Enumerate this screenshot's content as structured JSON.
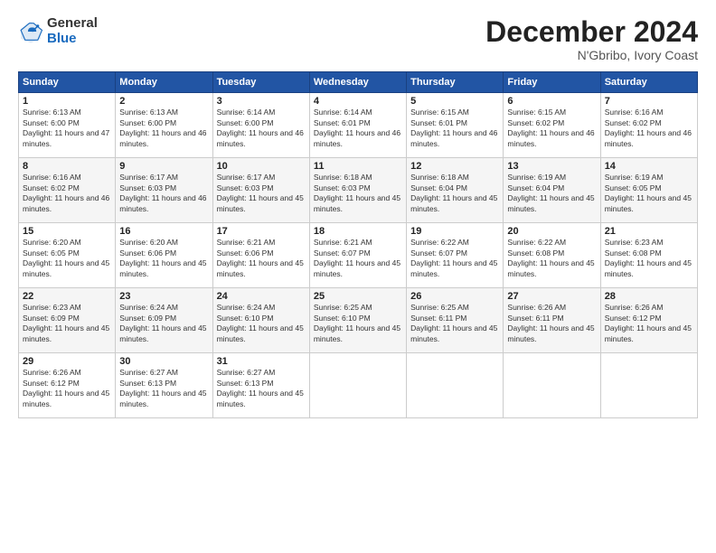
{
  "header": {
    "logo_general": "General",
    "logo_blue": "Blue",
    "month_title": "December 2024",
    "location": "N'Gbribo, Ivory Coast"
  },
  "columns": [
    "Sunday",
    "Monday",
    "Tuesday",
    "Wednesday",
    "Thursday",
    "Friday",
    "Saturday"
  ],
  "weeks": [
    [
      {
        "day": "1",
        "sunrise": "6:13 AM",
        "sunset": "6:00 PM",
        "daylight": "11 hours and 47 minutes."
      },
      {
        "day": "2",
        "sunrise": "6:13 AM",
        "sunset": "6:00 PM",
        "daylight": "11 hours and 46 minutes."
      },
      {
        "day": "3",
        "sunrise": "6:14 AM",
        "sunset": "6:00 PM",
        "daylight": "11 hours and 46 minutes."
      },
      {
        "day": "4",
        "sunrise": "6:14 AM",
        "sunset": "6:01 PM",
        "daylight": "11 hours and 46 minutes."
      },
      {
        "day": "5",
        "sunrise": "6:15 AM",
        "sunset": "6:01 PM",
        "daylight": "11 hours and 46 minutes."
      },
      {
        "day": "6",
        "sunrise": "6:15 AM",
        "sunset": "6:02 PM",
        "daylight": "11 hours and 46 minutes."
      },
      {
        "day": "7",
        "sunrise": "6:16 AM",
        "sunset": "6:02 PM",
        "daylight": "11 hours and 46 minutes."
      }
    ],
    [
      {
        "day": "8",
        "sunrise": "6:16 AM",
        "sunset": "6:02 PM",
        "daylight": "11 hours and 46 minutes."
      },
      {
        "day": "9",
        "sunrise": "6:17 AM",
        "sunset": "6:03 PM",
        "daylight": "11 hours and 46 minutes."
      },
      {
        "day": "10",
        "sunrise": "6:17 AM",
        "sunset": "6:03 PM",
        "daylight": "11 hours and 45 minutes."
      },
      {
        "day": "11",
        "sunrise": "6:18 AM",
        "sunset": "6:03 PM",
        "daylight": "11 hours and 45 minutes."
      },
      {
        "day": "12",
        "sunrise": "6:18 AM",
        "sunset": "6:04 PM",
        "daylight": "11 hours and 45 minutes."
      },
      {
        "day": "13",
        "sunrise": "6:19 AM",
        "sunset": "6:04 PM",
        "daylight": "11 hours and 45 minutes."
      },
      {
        "day": "14",
        "sunrise": "6:19 AM",
        "sunset": "6:05 PM",
        "daylight": "11 hours and 45 minutes."
      }
    ],
    [
      {
        "day": "15",
        "sunrise": "6:20 AM",
        "sunset": "6:05 PM",
        "daylight": "11 hours and 45 minutes."
      },
      {
        "day": "16",
        "sunrise": "6:20 AM",
        "sunset": "6:06 PM",
        "daylight": "11 hours and 45 minutes."
      },
      {
        "day": "17",
        "sunrise": "6:21 AM",
        "sunset": "6:06 PM",
        "daylight": "11 hours and 45 minutes."
      },
      {
        "day": "18",
        "sunrise": "6:21 AM",
        "sunset": "6:07 PM",
        "daylight": "11 hours and 45 minutes."
      },
      {
        "day": "19",
        "sunrise": "6:22 AM",
        "sunset": "6:07 PM",
        "daylight": "11 hours and 45 minutes."
      },
      {
        "day": "20",
        "sunrise": "6:22 AM",
        "sunset": "6:08 PM",
        "daylight": "11 hours and 45 minutes."
      },
      {
        "day": "21",
        "sunrise": "6:23 AM",
        "sunset": "6:08 PM",
        "daylight": "11 hours and 45 minutes."
      }
    ],
    [
      {
        "day": "22",
        "sunrise": "6:23 AM",
        "sunset": "6:09 PM",
        "daylight": "11 hours and 45 minutes."
      },
      {
        "day": "23",
        "sunrise": "6:24 AM",
        "sunset": "6:09 PM",
        "daylight": "11 hours and 45 minutes."
      },
      {
        "day": "24",
        "sunrise": "6:24 AM",
        "sunset": "6:10 PM",
        "daylight": "11 hours and 45 minutes."
      },
      {
        "day": "25",
        "sunrise": "6:25 AM",
        "sunset": "6:10 PM",
        "daylight": "11 hours and 45 minutes."
      },
      {
        "day": "26",
        "sunrise": "6:25 AM",
        "sunset": "6:11 PM",
        "daylight": "11 hours and 45 minutes."
      },
      {
        "day": "27",
        "sunrise": "6:26 AM",
        "sunset": "6:11 PM",
        "daylight": "11 hours and 45 minutes."
      },
      {
        "day": "28",
        "sunrise": "6:26 AM",
        "sunset": "6:12 PM",
        "daylight": "11 hours and 45 minutes."
      }
    ],
    [
      {
        "day": "29",
        "sunrise": "6:26 AM",
        "sunset": "6:12 PM",
        "daylight": "11 hours and 45 minutes."
      },
      {
        "day": "30",
        "sunrise": "6:27 AM",
        "sunset": "6:13 PM",
        "daylight": "11 hours and 45 minutes."
      },
      {
        "day": "31",
        "sunrise": "6:27 AM",
        "sunset": "6:13 PM",
        "daylight": "11 hours and 45 minutes."
      },
      null,
      null,
      null,
      null
    ]
  ]
}
